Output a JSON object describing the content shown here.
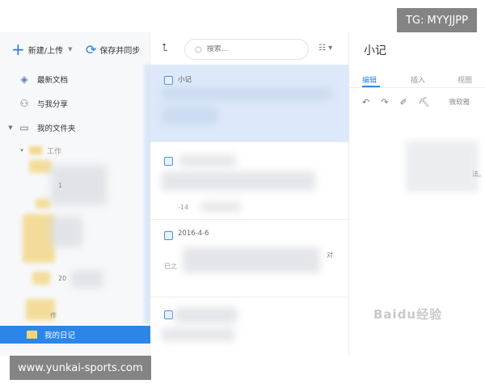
{
  "toolbar": {
    "new_upload": "新建/上传",
    "save_sync": "保存并同步"
  },
  "sidebar": {
    "items": [
      {
        "label": "最新文档",
        "icon": "layers-icon"
      },
      {
        "label": "与我分享",
        "icon": "share-user-icon"
      },
      {
        "label": "我的文件夹",
        "icon": "folder-icon"
      }
    ],
    "sub_folder": "工作",
    "partial_labels": [
      "1",
      " ",
      "20",
      "作"
    ],
    "selected_folder": "我的日记"
  },
  "list": {
    "search_placeholder": "搜索...",
    "notes": [
      {
        "title": "小记",
        "selected": true
      },
      {
        "title": "",
        "date_fragment": "-14"
      },
      {
        "title": "2016-4-6",
        "extra": "对",
        "snippet": "已之"
      },
      {
        "title": "",
        "snippet": ""
      }
    ]
  },
  "editor": {
    "title": "小记",
    "tabs": [
      "编辑",
      "插入",
      "视图"
    ],
    "font_label": "微软雅",
    "fragment": "法。"
  },
  "overlays": {
    "tg_label": "TG: MYYJJPP",
    "site_url": "www.yunkai-sports.com",
    "watermark": "Baidu经验"
  },
  "colors": {
    "accent": "#2b86e7",
    "selected_note": "#dde9fa",
    "folder": "#f4d47a"
  }
}
